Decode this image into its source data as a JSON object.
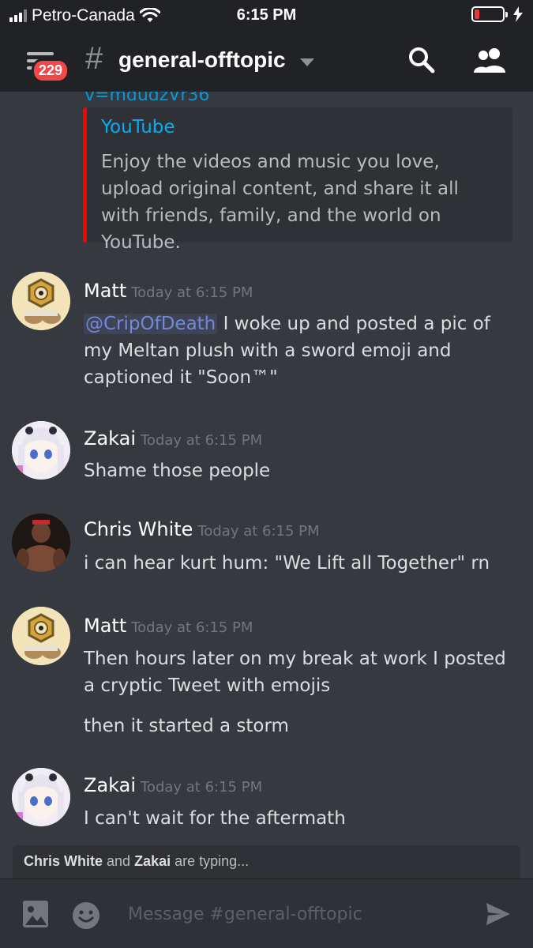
{
  "status_bar": {
    "carrier": "Petro-Canada",
    "time": "6:15 PM",
    "battery_level": 0.18
  },
  "header": {
    "badge_count": "229",
    "hash": "#",
    "channel_name": "general-offtopic"
  },
  "embed": {
    "cut_text": "v=mdudzVr36",
    "provider": "YouTube",
    "description": "Enjoy the videos and music you love, upload original content, and share it all with friends, family, and the world on YouTube.",
    "accent_color": "#ff0000"
  },
  "messages": [
    {
      "author": "Matt",
      "timestamp": "Today at 6:15 PM",
      "mention": "@CripOfDeath",
      "text": " I woke up and posted a pic of my Meltan plush with a sword emoji and captioned it \"Soon™\""
    },
    {
      "author": "Zakai",
      "timestamp": "Today at 6:15 PM",
      "text": "Shame those people"
    },
    {
      "author": "Chris White",
      "timestamp": "Today at 6:15 PM",
      "text": "i can hear kurt hum: \"We Lift all Together\" rn"
    },
    {
      "author": "Matt",
      "timestamp": "Today at 6:15 PM",
      "text": "Then hours later on my break at work I posted a cryptic Tweet with emojis",
      "text2": "then it started a storm"
    },
    {
      "author": "Zakai",
      "timestamp": "Today at 6:15 PM",
      "text": "I can't wait for the aftermath"
    }
  ],
  "typing": {
    "user1": "Chris White",
    "and": " and ",
    "user2": "Zakai",
    "suffix": " are typing..."
  },
  "composer": {
    "placeholder": "Message #general-offtopic"
  },
  "colors": {
    "background": "#36393f",
    "header": "#202225",
    "link": "#00b0f4",
    "mention": "#7289da",
    "badge": "#f04747"
  }
}
